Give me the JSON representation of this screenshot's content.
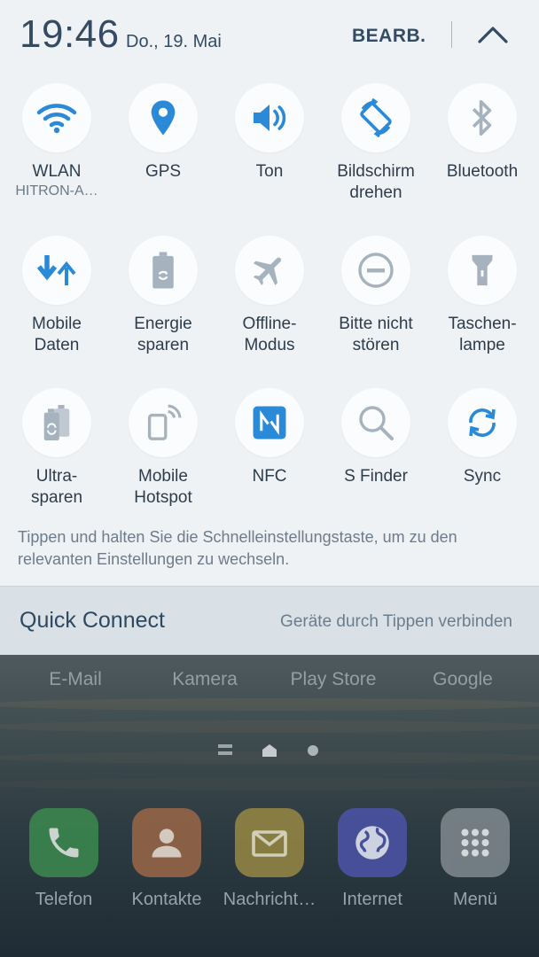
{
  "header": {
    "time": "19:46",
    "date": "Do., 19. Mai",
    "edit_label": "BEARB.",
    "collapse_icon": "chevron-up-icon"
  },
  "tiles": [
    {
      "label": "WLAN",
      "sub": "HITRON-A…",
      "icon": "wifi-icon",
      "active": true
    },
    {
      "label": "GPS",
      "icon": "location-pin-icon",
      "active": true
    },
    {
      "label": "Ton",
      "icon": "speaker-icon",
      "active": true
    },
    {
      "label": "Bildschirm drehen",
      "icon": "rotate-screen-icon",
      "active": true
    },
    {
      "label": "Bluetooth",
      "icon": "bluetooth-icon",
      "active": false
    },
    {
      "label": "Mobile Daten",
      "icon": "mobile-data-icon",
      "active": true
    },
    {
      "label": "Energie sparen",
      "icon": "battery-recycle-icon",
      "active": false
    },
    {
      "label": "Offline-Modus",
      "icon": "airplane-icon",
      "active": false
    },
    {
      "label": "Bitte nicht stören",
      "icon": "do-not-disturb-icon",
      "active": false
    },
    {
      "label": "Taschen-lampe",
      "icon": "flashlight-icon",
      "active": false
    },
    {
      "label": "Ultra-sparen",
      "icon": "ultra-power-saving-icon",
      "active": false
    },
    {
      "label": "Mobile Hotspot",
      "icon": "hotspot-icon",
      "active": false
    },
    {
      "label": "NFC",
      "icon": "nfc-icon",
      "active": true
    },
    {
      "label": "S Finder",
      "icon": "search-icon",
      "active": false
    },
    {
      "label": "Sync",
      "icon": "sync-icon",
      "active": true
    }
  ],
  "hint": "Tippen und halten Sie die Schnelleinstellungstaste, um zu den relevanten Einstellungen zu wechseln.",
  "quick_connect": {
    "title": "Quick Connect",
    "subtitle": "Geräte durch Tippen verbinden"
  },
  "home": {
    "app_row": [
      "E-Mail",
      "Kamera",
      "Play Store",
      "Google"
    ],
    "dock": [
      {
        "label": "Telefon",
        "icon": "phone-icon",
        "color": "#3f8f4e"
      },
      {
        "label": "Kontakte",
        "icon": "contacts-icon",
        "color": "#9a6a4a"
      },
      {
        "label": "Nachricht…",
        "icon": "message-icon",
        "color": "#9a8a45"
      },
      {
        "label": "Internet",
        "icon": "globe-icon",
        "color": "#4f57a2"
      },
      {
        "label": "Menü",
        "icon": "apps-grid-icon",
        "color": "#7d868c"
      }
    ]
  },
  "colors": {
    "accent": "#2a8ad8",
    "inactive": "#a6b3bf",
    "panel_bg": "#eef2f5"
  }
}
